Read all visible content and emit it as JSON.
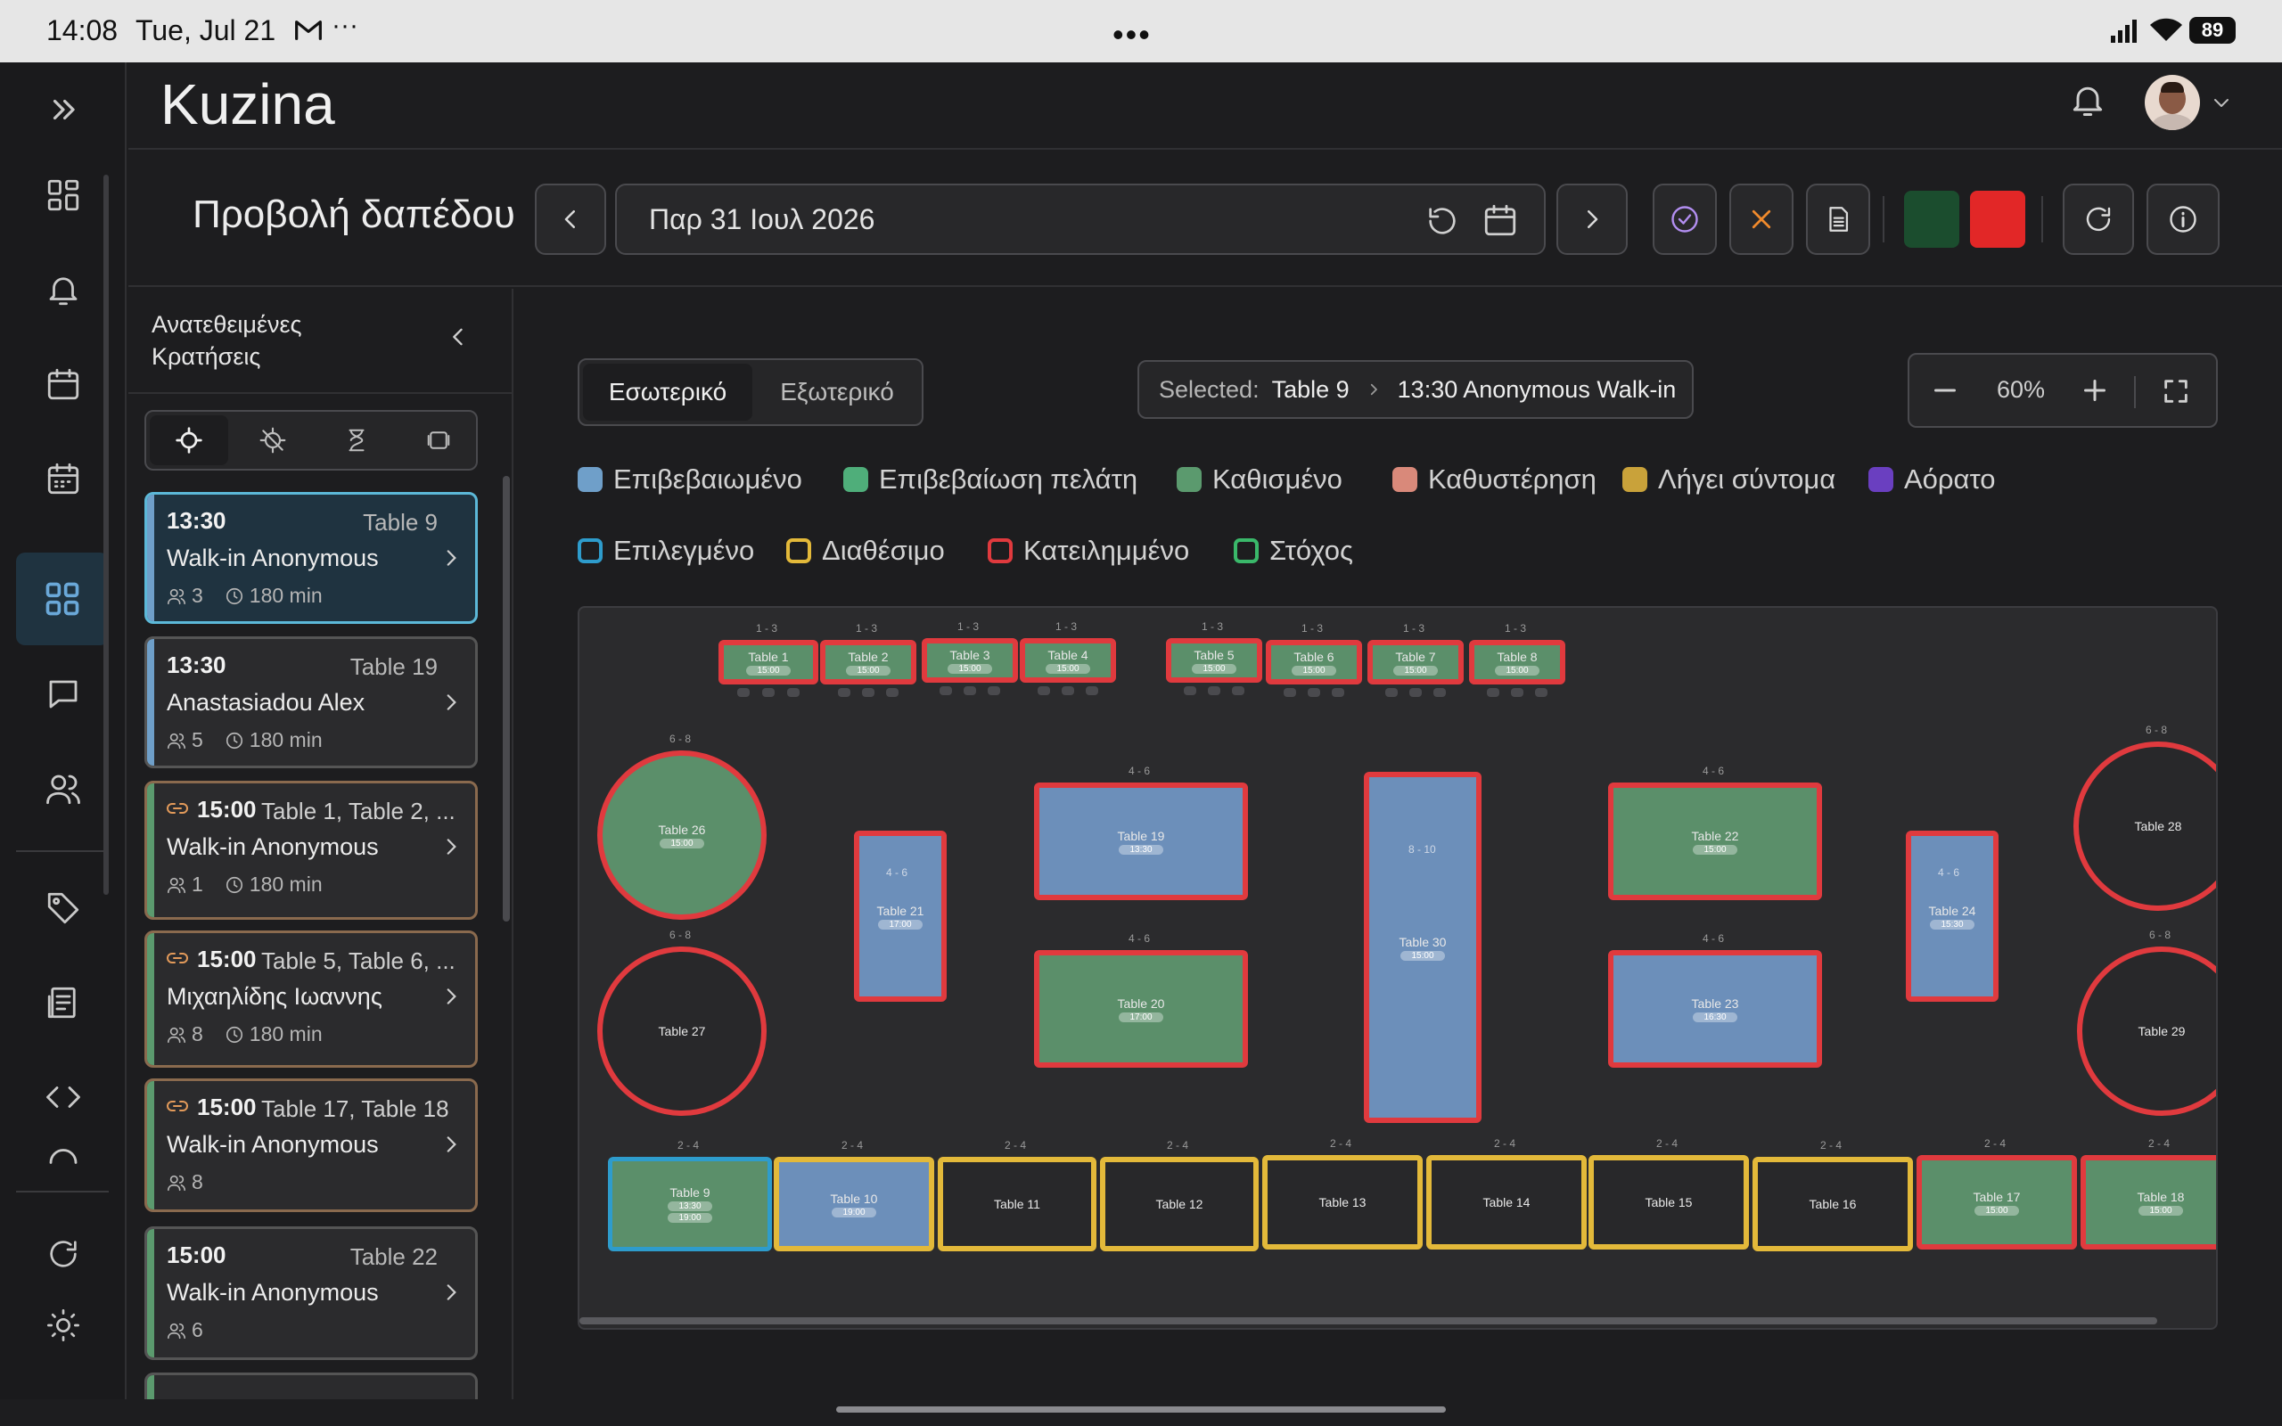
{
  "status_bar": {
    "time": "14:08",
    "date": "Tue, Jul 21",
    "battery": "89",
    "icons": [
      "mail-icon",
      "more-icon",
      "signal-icon",
      "wifi-icon",
      "battery-icon"
    ]
  },
  "app": {
    "title": "Kuzina"
  },
  "toolbar": {
    "page_title": "Προβολή δαπέδου",
    "date_value": "Παρ 31 Ιουλ 2026",
    "colors": {
      "green_swatch": "#1b4d2e",
      "red_swatch": "#e22727"
    }
  },
  "side_panel": {
    "title": "Ανατεθειμένες Κρατήσεις",
    "filters": [
      "crosshair-icon",
      "crosshair-off-icon",
      "hourglass-icon",
      "layers-icon"
    ],
    "reservations": [
      {
        "time": "13:30",
        "tables": "Table 9",
        "name": "Walk-in Anonymous",
        "guests": "3",
        "duration": "180 min",
        "color": "#6f9fc9",
        "linked": false,
        "selected": true
      },
      {
        "time": "13:30",
        "tables": "Table 19",
        "name": "Anastasiadou Alex",
        "guests": "5",
        "duration": "180 min",
        "color": "#6f9fc9",
        "linked": false,
        "selected": false
      },
      {
        "time": "15:00",
        "tables": "Table 1, Table 2, ...",
        "name": "Walk-in Anonymous",
        "guests": "1",
        "duration": "180 min",
        "color": "#5b9a6e",
        "linked": true,
        "selected": false
      },
      {
        "time": "15:00",
        "tables": "Table 5, Table 6, ...",
        "name": "Μιχαηλίδης Ιωαννης",
        "guests": "8",
        "duration": "180 min",
        "color": "#5b9a6e",
        "linked": true,
        "selected": false
      },
      {
        "time": "15:00",
        "tables": "Table 17, Table 18",
        "name": "Walk-in Anonymous",
        "guests": "8",
        "duration": "",
        "color": "#5b9a6e",
        "linked": true,
        "selected": false
      },
      {
        "time": "15:00",
        "tables": "Table 22",
        "name": "Walk-in Anonymous",
        "guests": "6",
        "duration": "",
        "color": "#5b9a6e",
        "linked": false,
        "selected": false
      }
    ]
  },
  "floor": {
    "tabs": [
      "Εσωτερικό",
      "Εξωτερικό"
    ],
    "active_tab": "Εσωτερικό",
    "selected_label": "Selected:",
    "selected_table": "Table 9",
    "selected_reservation": "13:30 Anonymous Walk-in",
    "zoom": "60%",
    "legend_fill": [
      {
        "label": "Επιβεβαιωμένο",
        "color": "#6f9fc9"
      },
      {
        "label": "Επιβεβαίωση πελάτη",
        "color": "#4fae7a"
      },
      {
        "label": "Καθισμένο",
        "color": "#5b9a6e"
      },
      {
        "label": "Καθυστέρηση",
        "color": "#d9897a"
      },
      {
        "label": "Λήγει σύντομα",
        "color": "#c9a23a"
      },
      {
        "label": "Αόρατο",
        "color": "#6a3fc0"
      }
    ],
    "legend_border": [
      {
        "label": "Επιλεγμένο",
        "color": "#2e9ccc"
      },
      {
        "label": "Διαθέσιμο",
        "color": "#e3b93a"
      },
      {
        "label": "Κατειλημμένο",
        "color": "#e03a3e"
      },
      {
        "label": "Στόχος",
        "color": "#3ab86a"
      }
    ],
    "tables": [
      {
        "name": "Table 1",
        "cap": "1 - 3",
        "fill": "green",
        "border": "red",
        "time": "15:00"
      },
      {
        "name": "Table 2",
        "cap": "1 - 3",
        "fill": "green",
        "border": "red",
        "time": "15:00"
      },
      {
        "name": "Table 3",
        "cap": "1 - 3",
        "fill": "green",
        "border": "red",
        "time": "15:00"
      },
      {
        "name": "Table 4",
        "cap": "1 - 3",
        "fill": "green",
        "border": "red",
        "time": "15:00"
      },
      {
        "name": "Table 5",
        "cap": "1 - 3",
        "fill": "green",
        "border": "red",
        "time": "15:00"
      },
      {
        "name": "Table 6",
        "cap": "1 - 3",
        "fill": "green",
        "border": "red",
        "time": "15:00"
      },
      {
        "name": "Table 7",
        "cap": "1 - 3",
        "fill": "green",
        "border": "red",
        "time": "15:00"
      },
      {
        "name": "Table 8",
        "cap": "1 - 3",
        "fill": "green",
        "border": "red",
        "time": "15:00"
      },
      {
        "name": "Table 26",
        "cap": "6 - 8",
        "fill": "green",
        "border": "red",
        "time": "15:00"
      },
      {
        "name": "Table 27",
        "cap": "6 - 8",
        "fill": "empty",
        "border": "red",
        "time": ""
      },
      {
        "name": "Table 21",
        "cap": "4 - 6",
        "fill": "blue",
        "border": "red",
        "time": "17:00"
      },
      {
        "name": "Table 19",
        "cap": "4 - 6",
        "fill": "blue",
        "border": "red",
        "time": "13:30"
      },
      {
        "name": "Table 20",
        "cap": "4 - 6",
        "fill": "green",
        "border": "red",
        "time": "17:00"
      },
      {
        "name": "Table 30",
        "cap": "8 - 10",
        "fill": "blue",
        "border": "red",
        "time": "15:00"
      },
      {
        "name": "Table 22",
        "cap": "4 - 6",
        "fill": "green",
        "border": "red",
        "time": "15:00"
      },
      {
        "name": "Table 23",
        "cap": "4 - 6",
        "fill": "blue",
        "border": "red",
        "time": "16:30"
      },
      {
        "name": "Table 24",
        "cap": "4 - 6",
        "fill": "blue",
        "border": "red",
        "time": "15:30"
      },
      {
        "name": "Table 28",
        "cap": "6 - 8",
        "fill": "empty",
        "border": "red",
        "time": ""
      },
      {
        "name": "Table 29",
        "cap": "6 - 8",
        "fill": "empty",
        "border": "red",
        "time": ""
      },
      {
        "name": "Table 9",
        "cap": "2 - 4",
        "fill": "green",
        "border": "selected",
        "time": "13:30",
        "time2": "19:00"
      },
      {
        "name": "Table 10",
        "cap": "2 - 4",
        "fill": "blue",
        "border": "yellow",
        "time": "19:00"
      },
      {
        "name": "Table 11",
        "cap": "2 - 4",
        "fill": "empty",
        "border": "yellow",
        "time": ""
      },
      {
        "name": "Table 12",
        "cap": "2 - 4",
        "fill": "empty",
        "border": "yellow",
        "time": ""
      },
      {
        "name": "Table 13",
        "cap": "2 - 4",
        "fill": "empty",
        "border": "yellow",
        "time": ""
      },
      {
        "name": "Table 14",
        "cap": "2 - 4",
        "fill": "empty",
        "border": "yellow",
        "time": ""
      },
      {
        "name": "Table 15",
        "cap": "2 - 4",
        "fill": "empty",
        "border": "yellow",
        "time": ""
      },
      {
        "name": "Table 16",
        "cap": "2 - 4",
        "fill": "empty",
        "border": "yellow",
        "time": ""
      },
      {
        "name": "Table 17",
        "cap": "2 - 4",
        "fill": "green",
        "border": "red",
        "time": "15:00"
      },
      {
        "name": "Table 18",
        "cap": "2 - 4",
        "fill": "green",
        "border": "red",
        "time": "15:00"
      }
    ]
  }
}
